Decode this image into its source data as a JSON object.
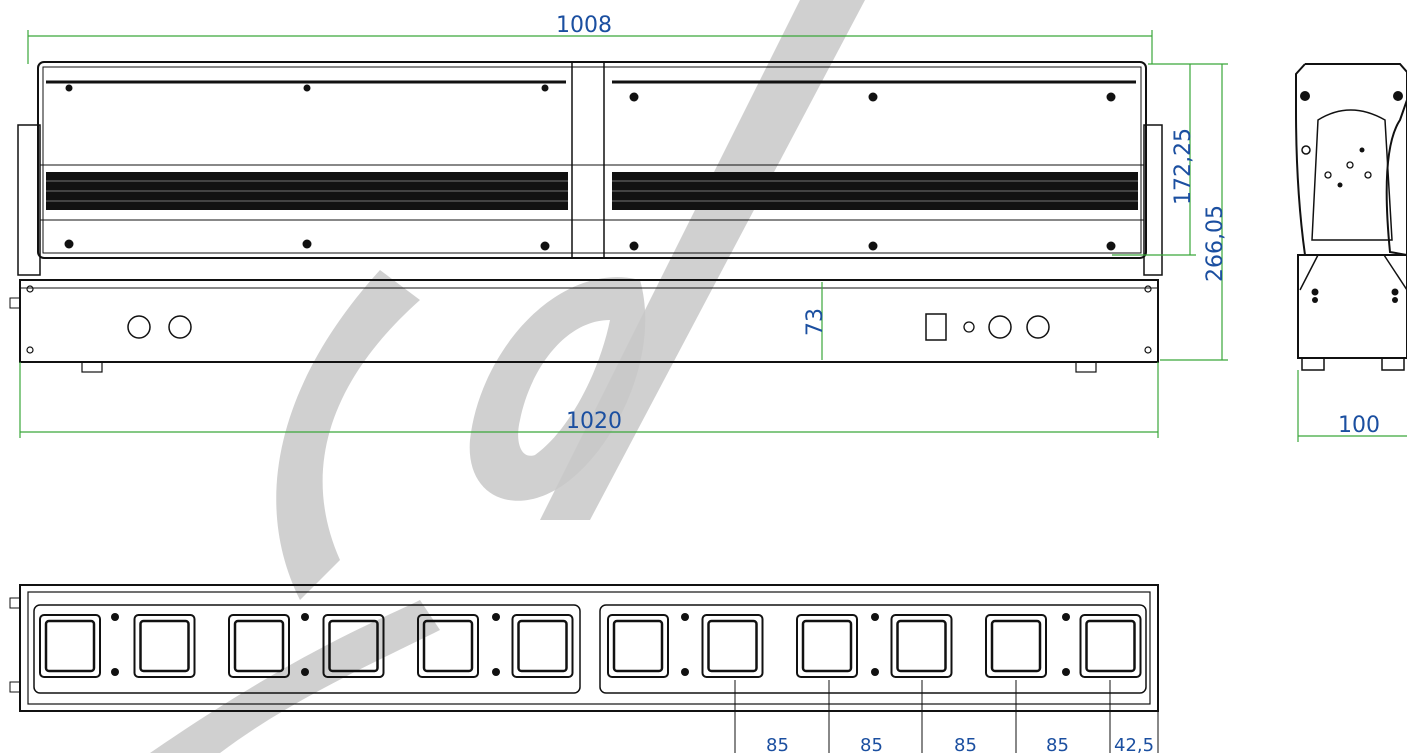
{
  "drawing": {
    "colors": {
      "dimension_text": "#1b4fa0",
      "dimension_line": "#3aa63a",
      "outline": "#111111",
      "watermark": "#c8c8c8"
    },
    "dimensions": {
      "top_width": "1008",
      "overall_width": "1020",
      "height_upper": "172,25",
      "height_total": "266,05",
      "base_height": "73",
      "side_depth": "100",
      "pitch_1": "85",
      "pitch_2": "85",
      "pitch_3": "85",
      "pitch_4": "85",
      "half_pitch": "42,5"
    },
    "views": [
      "front-view",
      "side-view",
      "bottom-view"
    ],
    "lens_count": 12
  }
}
